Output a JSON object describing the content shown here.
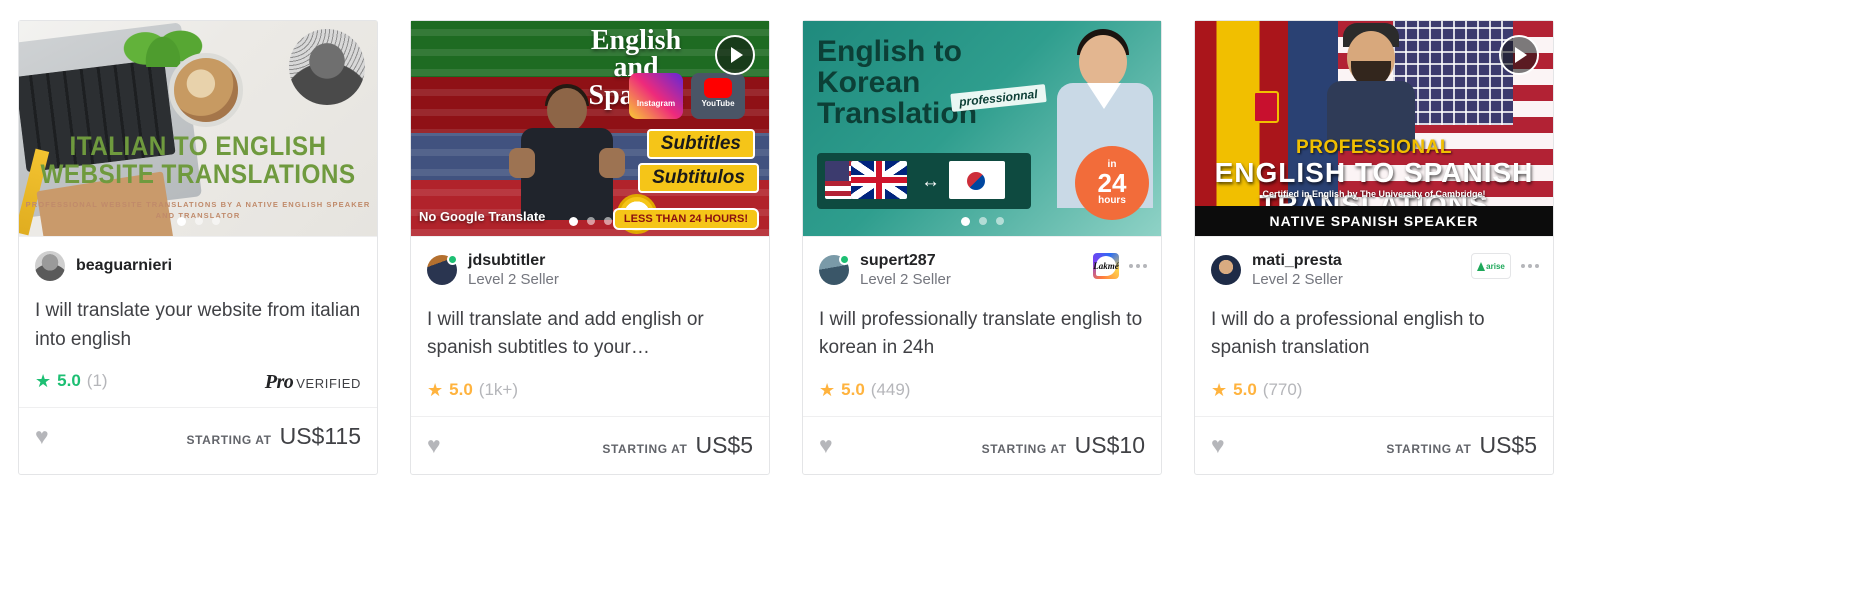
{
  "cards": [
    {
      "thumb": {
        "headline": "Italian to English Website Translations",
        "subline": "Professional website translations by a native english speaker and translator",
        "has_play_button": false,
        "dots": 3,
        "active_dot": 0
      },
      "seller": {
        "name": "beaguarnieri",
        "level": "",
        "online": false,
        "badge": "",
        "has_kebab": false
      },
      "title": "I will translate your website from italian into english",
      "rating": {
        "value": "5.0",
        "count": "(1)",
        "color": "#1dbf73",
        "star_icon": "star-icon"
      },
      "pro_verified": {
        "visible": true,
        "pro_label": "Pro",
        "verified_label": "VERIFIED"
      },
      "footer": {
        "favorite_icon": "heart-icon",
        "price_label": "Starting at",
        "price_value": "US$115"
      }
    },
    {
      "thumb": {
        "headline_line1": "English",
        "headline_line2": "and",
        "headline_line3": "Spanish",
        "subtitles_en": "Subtitles",
        "subtitles_es": "Subtitulos",
        "instagram_label": "Instagram",
        "youtube_label": "YouTube",
        "no_google": "No Google Translate",
        "badge_24h": "LESS THAN 24 HOURS!",
        "has_play_button": true,
        "dots": 3,
        "active_dot": 0
      },
      "seller": {
        "name": "jdsubtitler",
        "level": "Level 2 Seller",
        "online": true,
        "badge": "",
        "has_kebab": false
      },
      "title": "I will translate and add english or spanish subtitles to your…",
      "rating": {
        "value": "5.0",
        "count": "(1k+)",
        "color": "#ffb33e",
        "star_icon": "star-icon"
      },
      "pro_verified": {
        "visible": false,
        "pro_label": "",
        "verified_label": ""
      },
      "footer": {
        "favorite_icon": "heart-icon",
        "price_label": "Starting at",
        "price_value": "US$5"
      }
    },
    {
      "thumb": {
        "headline": "English to Korean Translation",
        "professional_tag": "professionnal",
        "badge_small": "in",
        "badge_big": "24",
        "badge_unit": "hours",
        "has_play_button": false,
        "dots": 3,
        "active_dot": 0
      },
      "seller": {
        "name": "supert287",
        "level": "Level 2 Seller",
        "online": true,
        "badge": "lakme-brand-logo",
        "badge_text": "Lakmé",
        "has_kebab": true
      },
      "title": "I will professionally translate english to korean in 24h",
      "rating": {
        "value": "5.0",
        "count": "(449)",
        "color": "#ffb33e",
        "star_icon": "star-icon"
      },
      "pro_verified": {
        "visible": false,
        "pro_label": "",
        "verified_label": ""
      },
      "footer": {
        "favorite_icon": "heart-icon",
        "price_label": "Starting at",
        "price_value": "US$10"
      }
    },
    {
      "thumb": {
        "headline_small": "Professional",
        "headline_line1": "English to Spanish",
        "headline_line2": "Translations",
        "certified_line": "Certified in English by The University of Cambridge!",
        "bottom_band": "Native Spanish Speaker",
        "has_play_button": true,
        "dots": 0,
        "active_dot": -1
      },
      "seller": {
        "name": "mati_presta",
        "level": "Level 2 Seller",
        "online": false,
        "badge": "arise-brand-logo",
        "badge_text": "arise",
        "has_kebab": true
      },
      "title": "I will do a professional english to spanish translation",
      "rating": {
        "value": "5.0",
        "count": "(770)",
        "color": "#ffb33e",
        "star_icon": "star-icon"
      },
      "pro_verified": {
        "visible": false,
        "pro_label": "",
        "verified_label": ""
      },
      "footer": {
        "favorite_icon": "heart-icon",
        "price_label": "Starting at",
        "price_value": "US$5"
      }
    }
  ],
  "icons": {
    "heart": "♥",
    "star": "★",
    "play": "▶"
  }
}
